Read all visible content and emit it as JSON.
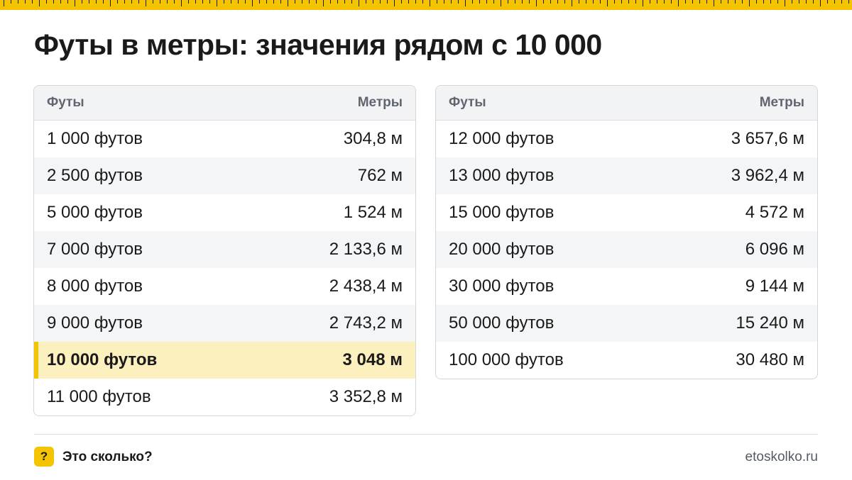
{
  "title": "Футы в метры: значения рядом с 10 000",
  "colors": {
    "accent": "#f5c400",
    "highlight_row": "#fdf0bf",
    "header_bg": "#f2f3f5",
    "stripe": "#f4f5f7"
  },
  "tables": [
    {
      "headers": {
        "feet": "Футы",
        "meters": "Метры"
      },
      "rows": [
        {
          "feet": "1 000 футов",
          "meters": "304,8 м"
        },
        {
          "feet": "2 500 футов",
          "meters": "762 м"
        },
        {
          "feet": "5 000 футов",
          "meters": "1 524 м"
        },
        {
          "feet": "7 000 футов",
          "meters": "2 133,6 м"
        },
        {
          "feet": "8 000 футов",
          "meters": "2 438,4 м"
        },
        {
          "feet": "9 000 футов",
          "meters": "2 743,2 м"
        },
        {
          "feet": "10 000 футов",
          "meters": "3 048 м"
        },
        {
          "feet": "11 000 футов",
          "meters": "3 352,8 м"
        }
      ]
    },
    {
      "headers": {
        "feet": "Футы",
        "meters": "Метры"
      },
      "rows": [
        {
          "feet": "12 000 футов",
          "meters": "3 657,6 м"
        },
        {
          "feet": "13 000 футов",
          "meters": "3 962,4 м"
        },
        {
          "feet": "15 000 футов",
          "meters": "4 572 м"
        },
        {
          "feet": "20 000 футов",
          "meters": "6 096 м"
        },
        {
          "feet": "30 000 футов",
          "meters": "9 144 м"
        },
        {
          "feet": "50 000 футов",
          "meters": "15 240 м"
        },
        {
          "feet": "100 000 футов",
          "meters": "30 480 м"
        }
      ]
    }
  ],
  "footer": {
    "badge": "?",
    "brand": "Это сколько?",
    "site": "etoskolko.ru"
  }
}
